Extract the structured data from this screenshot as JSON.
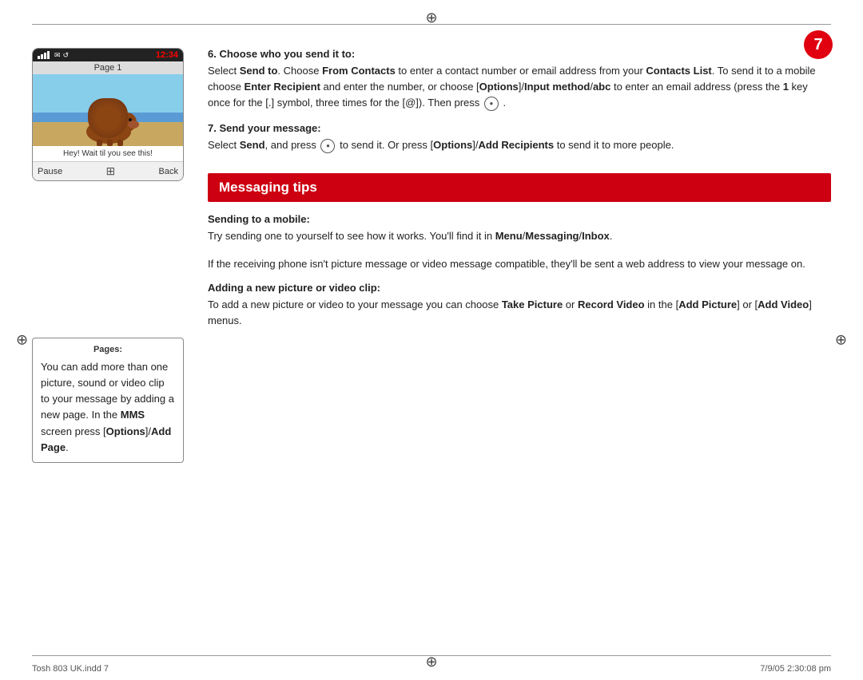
{
  "page": {
    "number": "7",
    "footer_left": "Tosh 803 UK.indd   7",
    "footer_right": "7/9/05   2:30:08 pm"
  },
  "phone": {
    "signal": "|||",
    "icons": "✉ ↺",
    "time": "12:34",
    "page_label": "Page 1",
    "caption": "Hey! Wait til you see this!",
    "pause_label": "Pause",
    "back_label": "Back"
  },
  "pages_box": {
    "title": "Pages:",
    "text": "You can add more than one picture, sound or video clip to your message by adding a new page. In the MMS screen press [Options]/Add Page."
  },
  "section6": {
    "heading": "6. Choose who you send it to:",
    "para1": "Select Send to. Choose From Contacts to enter a contact number or email address from your Contacts List. To send it to a mobile choose Enter Recipient and enter the number, or choose [Options]/Input method/abc to enter an email address (press the 1 key once for the [.] symbol, three times for the [@]). Then press    .",
    "para1_parts": {
      "before_sendto": "Select ",
      "sendto": "Send to",
      "between1": ". Choose ",
      "fromcontacts": "From Contacts",
      "between2": " to enter a contact number or email address from your ",
      "contacts": "Contacts List",
      "period": ". To send it to a mobile choose ",
      "enterrecipient": "Enter Recipient",
      "between3": " and enter the number, or choose [",
      "options": "Options",
      "slash": "]/",
      "input": "Input method",
      "slash2": "/",
      "abc": "abc",
      "between4": " to enter an email address (press the ",
      "one": "1",
      "between5": " key once for the [.] symbol, three times for the [@]). Then press",
      "after": " ."
    }
  },
  "section7": {
    "heading": "7. Send your message:",
    "para": "Select Send, and press   to send it. Or press [Options]/Add Recipients to send it to more people.",
    "para_parts": {
      "before": "Select ",
      "send": "Send",
      "between": ", and press",
      "after": "to send it. Or press [",
      "options": "Options",
      "slash": "]/",
      "addrecipients": "Add Recipients",
      "end": " to send it to more people."
    }
  },
  "messaging_tips": {
    "banner": "Messaging tips",
    "sending": {
      "heading": "Sending to a mobile:",
      "text": "Try sending one to yourself to see how it works. You'll find it in Menu/Messaging/Inbox.",
      "text_bold": "Menu/Messaging/Inbox",
      "text2": "If the receiving phone isn't picture message or video message compatible, they'll be sent a web address to view your message on."
    },
    "adding": {
      "heading": "Adding a new picture or video clip:",
      "text_before": "To add a new picture or video to your message you can choose ",
      "takepicture": "Take Picture",
      "or": " or ",
      "recordvideo": "Record Video",
      "in": " in the [",
      "addpicture": "Add Picture",
      "or2": "] or [",
      "addvideo": "Add Video",
      "end": "] menus."
    }
  }
}
